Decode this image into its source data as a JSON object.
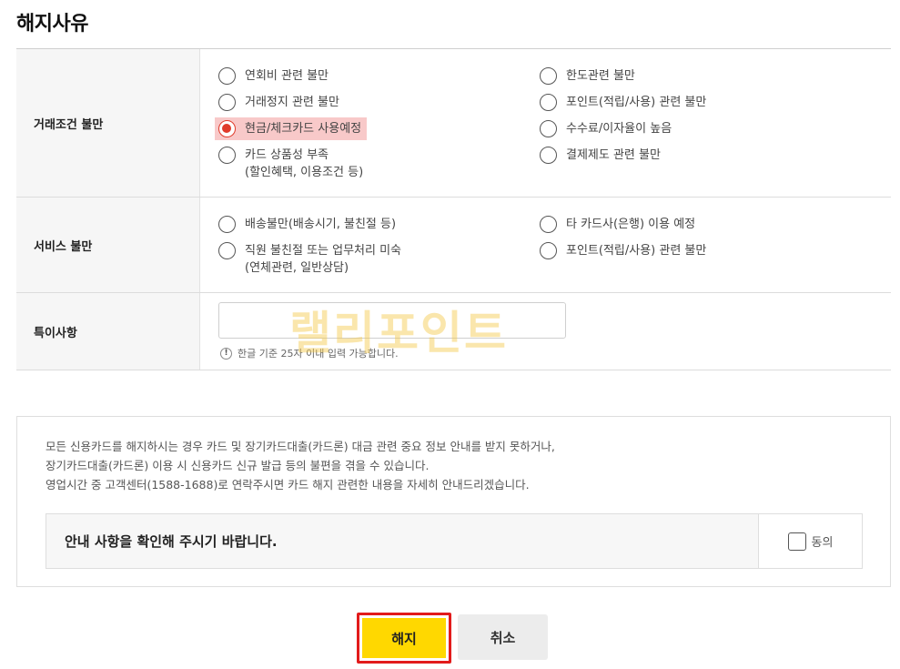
{
  "page": {
    "title": "해지사유"
  },
  "sections": {
    "trade": {
      "label": "거래조건 불만",
      "options": [
        {
          "text": "연회비 관련 불만",
          "sub": "",
          "checked": false
        },
        {
          "text": "한도관련 불만",
          "sub": "",
          "checked": false
        },
        {
          "text": "거래정지 관련 불만",
          "sub": "",
          "checked": false
        },
        {
          "text": "포인트(적립/사용) 관련 불만",
          "sub": "",
          "checked": false
        },
        {
          "text": "현금/체크카드 사용예정",
          "sub": "",
          "checked": true
        },
        {
          "text": "수수료/이자율이 높음",
          "sub": "",
          "checked": false
        },
        {
          "text": "카드 상품성 부족",
          "sub": "(할인혜택, 이용조건 등)",
          "checked": false
        },
        {
          "text": "결제제도 관련 불만",
          "sub": "",
          "checked": false
        }
      ]
    },
    "service": {
      "label": "서비스 불만",
      "options": [
        {
          "text": "배송불만(배송시기, 불친절 등)",
          "sub": "",
          "checked": false
        },
        {
          "text": "타 카드사(은행) 이용 예정",
          "sub": "",
          "checked": false
        },
        {
          "text": "직원 불친절 또는 업무처리 미숙",
          "sub": "(연체관련, 일반상담)",
          "checked": false
        },
        {
          "text": "포인트(적립/사용) 관련 불만",
          "sub": "",
          "checked": false
        }
      ]
    },
    "note": {
      "label": "특이사항",
      "value": "",
      "hint_icon": "!",
      "hint": "한글 기준 25자 이내 입력 가능합니다."
    }
  },
  "watermark": "랠리포인트",
  "notice": {
    "lines": [
      "모든 신용카드를 해지하시는 경우 카드 및 장기카드대출(카드론) 대금 관련 중요 정보 안내를 받지 못하거나,",
      "장기카드대출(카드론) 이용 시 신용카드 신규 발급 등의 불편을 겪을 수 있습니다.",
      "영업시간 중 고객센터(1588-1688)로 연락주시면 카드 해지 관련한 내용을 자세히 안내드리겠습니다."
    ],
    "confirm_label": "안내 사항을 확인해 주시기 바랍니다.",
    "agree_label": "동의",
    "agree_checked": false
  },
  "buttons": {
    "terminate": "해지",
    "cancel": "취소"
  },
  "colors": {
    "accent_yellow": "#ffd800",
    "highlight_red": "#e21b1b",
    "radio_checked": "#e03b2b"
  }
}
